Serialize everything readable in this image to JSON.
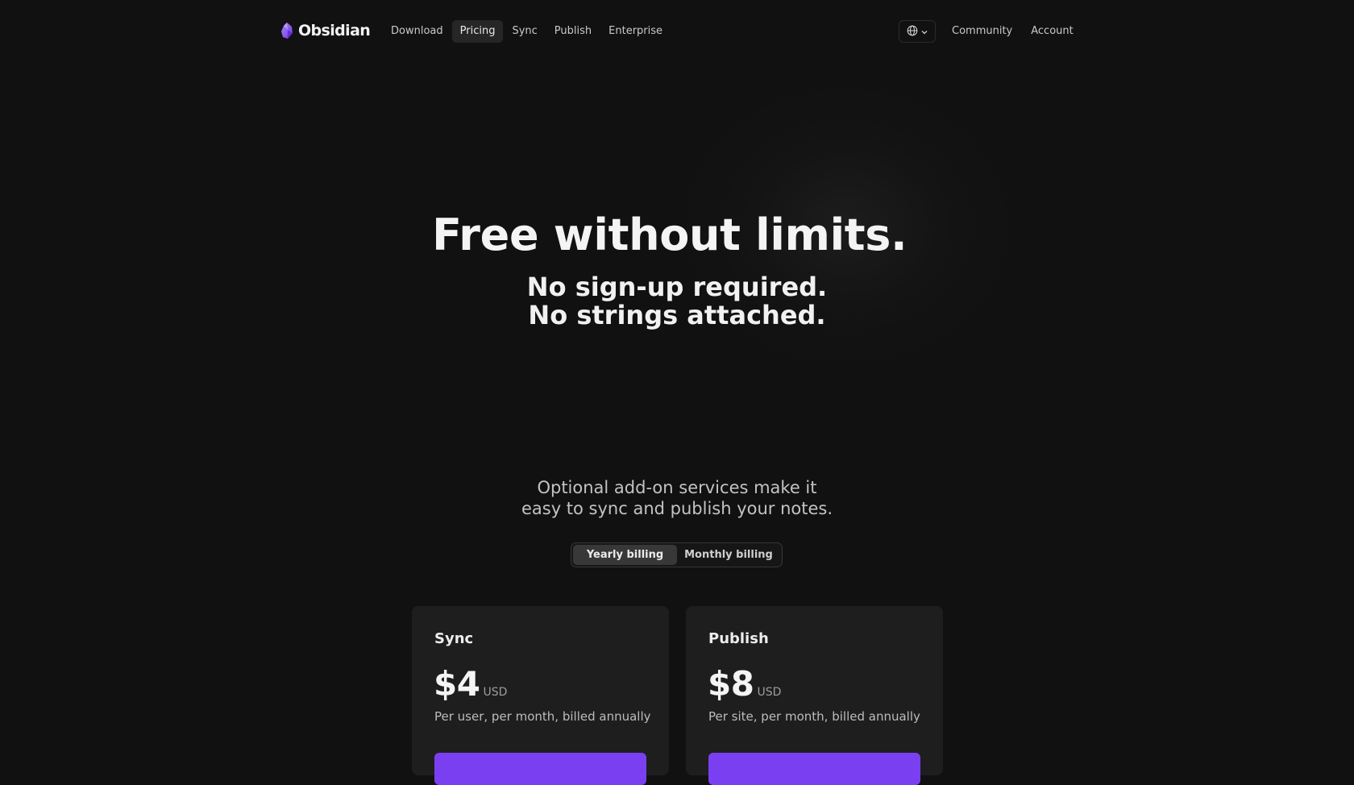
{
  "nav": {
    "logo_text": "Obsidian",
    "links": [
      {
        "label": "Download"
      },
      {
        "label": "Pricing"
      },
      {
        "label": "Sync"
      },
      {
        "label": "Publish"
      },
      {
        "label": "Enterprise"
      }
    ],
    "right_links": [
      {
        "label": "Community"
      },
      {
        "label": "Account"
      }
    ],
    "language_icon": "globe-icon"
  },
  "hero": {
    "title": "Free without limits.",
    "subtitle_line1": "No sign-up required.",
    "subtitle_line2": "No strings attached.",
    "underline_color": "#27c562"
  },
  "addons": {
    "line1": "Optional add-on services make it",
    "line2": "easy to sync and publish your notes."
  },
  "billing": {
    "yearly_label": "Yearly billing",
    "monthly_label": "Monthly billing",
    "selected": "Yearly billing"
  },
  "plans": [
    {
      "name": "Sync",
      "price": "$4",
      "currency": "USD",
      "description": "Per user, per month, billed annually"
    },
    {
      "name": "Publish",
      "price": "$8",
      "currency": "USD",
      "description": "Per site, per month, billed annually"
    }
  ],
  "colors": {
    "background": "#111111",
    "accent": "#7b3ff2",
    "card": "#1e1e1e"
  }
}
